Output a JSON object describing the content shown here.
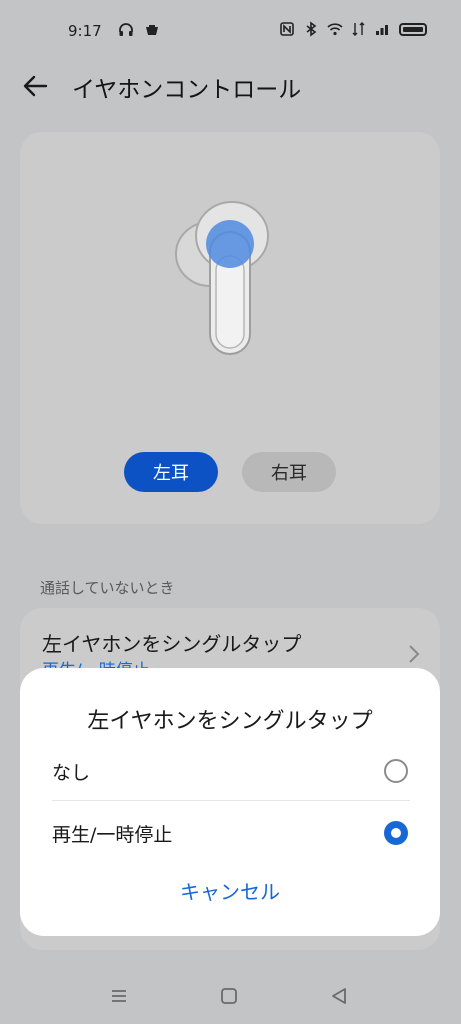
{
  "status_bar": {
    "time": "9:17",
    "left_icons": [
      "headphones-icon",
      "notification-icon"
    ],
    "right_icons": [
      "nfc-icon",
      "bluetooth-icon",
      "wifi-icon",
      "data-icon",
      "signal-icon",
      "battery-icon"
    ]
  },
  "app_bar": {
    "title": "イヤホンコントロール"
  },
  "hero": {
    "left_ear_label": "左耳",
    "right_ear_label": "右耳",
    "selected": "左耳"
  },
  "section": {
    "header": "通話していないとき"
  },
  "setting_row": {
    "title": "左イヤホンをシングルタップ",
    "value": "再生/一時停止"
  },
  "dialog": {
    "title": "左イヤホンをシングルタップ",
    "options": [
      {
        "label": "なし",
        "selected": false
      },
      {
        "label": "再生/一時停止",
        "selected": true
      }
    ],
    "cancel_label": "キャンセル"
  },
  "colors": {
    "accent": "#1767d6",
    "selected_toggle": "#0c52c4",
    "scrim_background": "#c2c4c6"
  }
}
